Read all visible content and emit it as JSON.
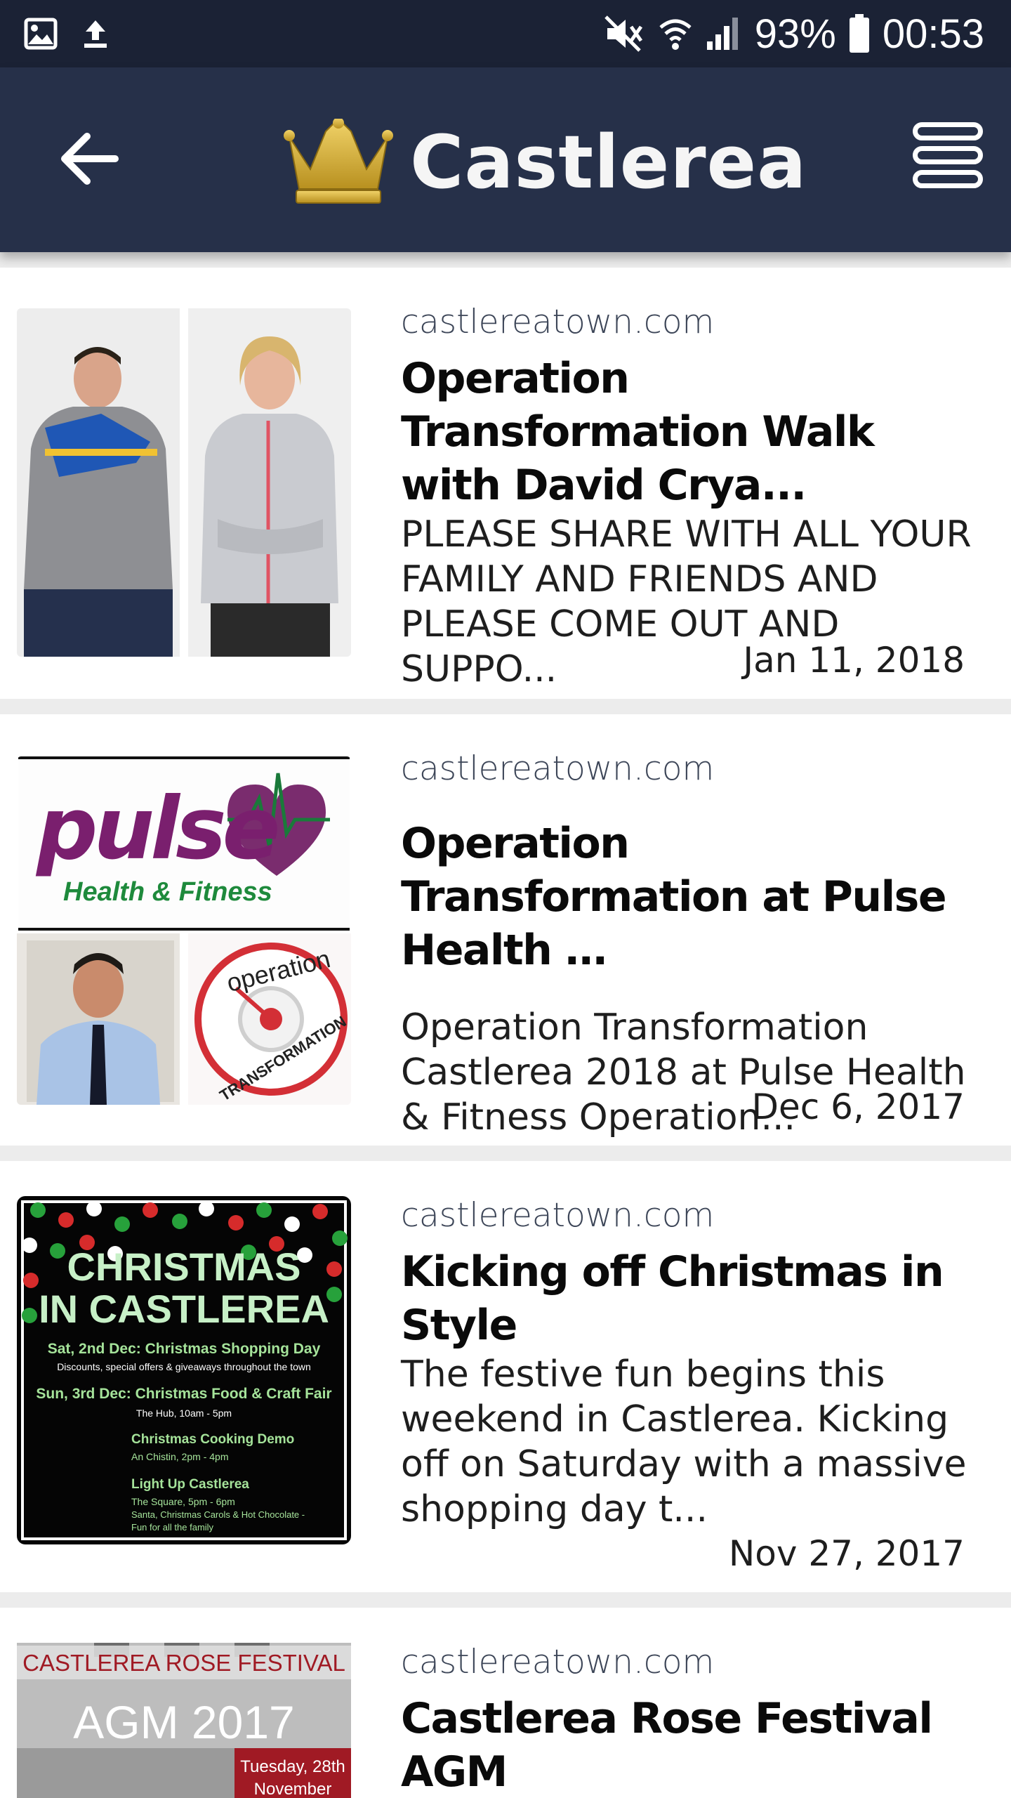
{
  "status_bar": {
    "battery": "93%",
    "time": "00:53",
    "icons": [
      "image-icon",
      "upload-icon",
      "mute-icon",
      "wifi-icon",
      "signal-icon",
      "battery-icon"
    ]
  },
  "app_bar": {
    "title": "Castlerea",
    "back_icon": "arrow-left-icon",
    "menu_icon": "menu-icon",
    "logo_icon": "crown-icon",
    "accent": "#d8b23a",
    "background": "#263049"
  },
  "articles": [
    {
      "source": "castlereatown.com",
      "title": "Operation Transformation Walk with David Crya...",
      "snippet": "PLEASE SHARE WITH ALL YOUR FAMILY AND FRIENDS AND PLEASE COME OUT AND SUPPO...",
      "date": "Jan 11, 2018"
    },
    {
      "source": "castlereatown.com",
      "title": "Operation Transformation at Pulse Health …",
      "snippet": "Operation Transformation Castlerea 2018 at Pulse Health & Fitness Operation...",
      "date": "Dec 6, 2017",
      "image_text": {
        "brand": "pulse",
        "brand_sub": "Health & Fitness",
        "badge_top": "operation",
        "badge_bottom": "TRANSFORMATION"
      }
    },
    {
      "source": "castlereatown.com",
      "title": "Kicking off Christmas in Style",
      "snippet": "The festive fun begins this weekend in Castlerea. Kicking off on Saturday with a massive shopping day t...",
      "date": "Nov 27, 2017",
      "image_text": {
        "heading1": "CHRISTMAS",
        "heading2": "IN CASTLEREA",
        "line1": "Sat, 2nd Dec: Christmas Shopping Day",
        "line1_sub": "Discounts, special offers & giveaways throughout the town",
        "line2": "Sun, 3rd Dec: Christmas Food & Craft Fair",
        "line2_sub": "The Hub, 10am - 5pm",
        "line3": "Christmas Cooking Demo",
        "line3_sub": "An Chistin, 2pm - 4pm",
        "line4": "Light Up Castlerea",
        "line4_sub": "The Square, 5pm - 6pm",
        "line5_sub": "Santa, Christmas Carols & Hot Chocolate -",
        "line6_sub": "Fun for all the family"
      }
    },
    {
      "source": "castlereatown.com",
      "title": "Castlerea Rose Festival AGM",
      "snippet": "",
      "date": "",
      "image_text": {
        "header": "CASTLEREA ROSE FESTIVAL",
        "big": "AGM 2017",
        "tag1": "Tuesday, 28th",
        "tag2": "November"
      }
    }
  ]
}
